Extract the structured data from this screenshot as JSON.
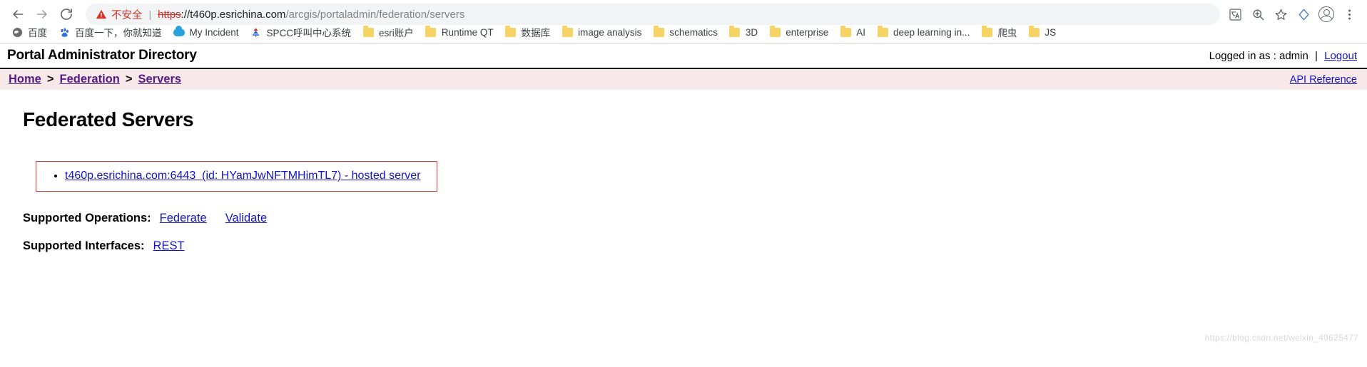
{
  "browser": {
    "nav": {
      "back_icon": "arrow-left-icon",
      "forward_icon": "arrow-right-icon",
      "reload_icon": "reload-icon"
    },
    "omnibox": {
      "security_icon": "warning-triangle-icon",
      "security_label": "不安全",
      "separator": "|",
      "url_scheme": "https",
      "url_scheme_suffix": "://",
      "url_host": "t460p.esrichina.com",
      "url_path": "/arcgis/portaladmin/federation/servers",
      "full_url": "https://t460p.esrichina.com/arcgis/portaladmin/federation/servers"
    },
    "toolbar_icons": [
      {
        "name": "translate-icon",
        "glyph": "文A"
      },
      {
        "name": "zoom-icon",
        "glyph": "search-plus"
      },
      {
        "name": "bookmark-star-icon",
        "glyph": "star"
      },
      {
        "name": "extension-icon",
        "glyph": "diamond"
      },
      {
        "name": "profile-icon",
        "glyph": "avatar"
      },
      {
        "name": "menu-icon",
        "glyph": "kebab"
      }
    ],
    "bookmarks": [
      {
        "label": "百度",
        "icon": "baidu-globe-icon"
      },
      {
        "label": "百度一下，你就知道",
        "icon": "baidu-paw-icon"
      },
      {
        "label": "My Incident",
        "icon": "cloud-icon"
      },
      {
        "label": "SPCC呼叫中心系统",
        "icon": "tree-icon"
      },
      {
        "label": "esri账户",
        "icon": "folder-icon"
      },
      {
        "label": "Runtime QT",
        "icon": "folder-icon"
      },
      {
        "label": "数据库",
        "icon": "folder-icon"
      },
      {
        "label": "image analysis",
        "icon": "folder-icon"
      },
      {
        "label": "schematics",
        "icon": "folder-icon"
      },
      {
        "label": "3D",
        "icon": "folder-icon"
      },
      {
        "label": "enterprise",
        "icon": "folder-icon"
      },
      {
        "label": "AI",
        "icon": "folder-icon"
      },
      {
        "label": "deep learning in...",
        "icon": "folder-icon"
      },
      {
        "label": "爬虫",
        "icon": "folder-icon"
      },
      {
        "label": "JS",
        "icon": "folder-icon"
      }
    ]
  },
  "portal": {
    "title": "Portal Administrator Directory",
    "logged_in_prefix": "Logged in as : admin",
    "logged_in_separator": "|",
    "logout_label": "Logout",
    "api_reference_label": "API Reference",
    "breadcrumb": {
      "home": "Home",
      "sep1": ">",
      "federation": "Federation",
      "sep2": ">",
      "servers": "Servers"
    },
    "heading": "Federated Servers",
    "servers": [
      {
        "label": "t460p.esrichina.com:6443  (id: HYamJwNFTMHimTL7) - hosted server",
        "host": "t460p.esrichina.com",
        "port": "6443",
        "id": "HYamJwNFTMHimTL7",
        "role": "hosted server"
      }
    ],
    "supported_operations": {
      "label": "Supported Operations:",
      "links": [
        "Federate",
        "Validate"
      ]
    },
    "supported_interfaces": {
      "label": "Supported Interfaces:",
      "links": [
        "REST"
      ]
    },
    "watermark": "https://blog.csdn.net/weixin_40625477"
  },
  "colors": {
    "insecure_red": "#d93025",
    "link_blue": "#1414cc",
    "visited_purple": "#551a8b",
    "breadcrumb_bg": "#f7e9e9",
    "highlight_border": "#e03c3c",
    "folder_yellow": "#f6d365"
  }
}
